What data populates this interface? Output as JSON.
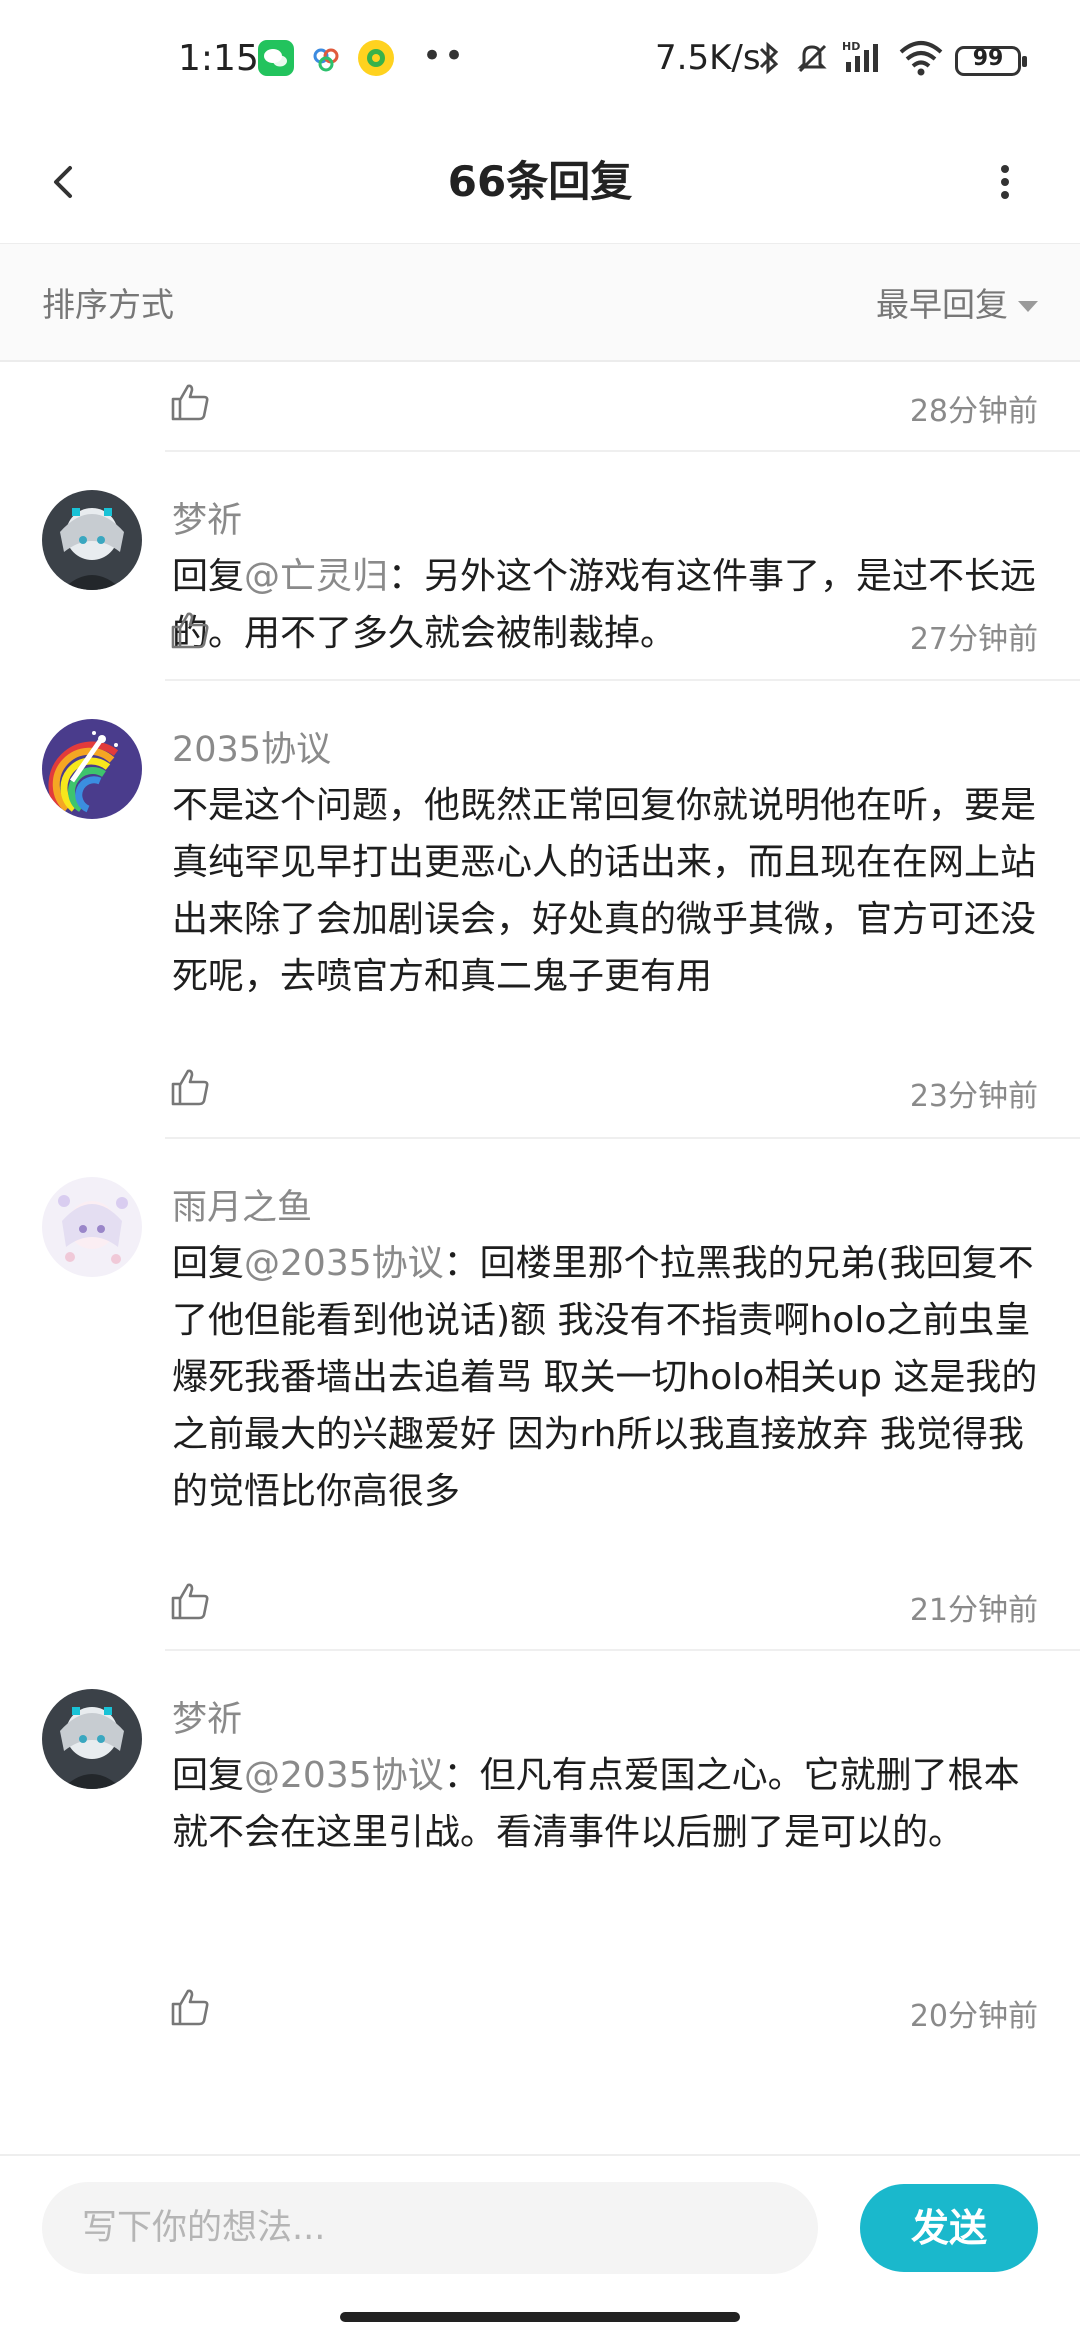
{
  "status_bar": {
    "time": "1:15",
    "net_speed": "7.5K/s",
    "battery": "99",
    "app_icons": [
      "wechat-icon",
      "cloud-app-icon",
      "qq-browser-icon"
    ]
  },
  "header": {
    "title": "66条回复"
  },
  "sort": {
    "label": "排序方式",
    "selected": "最早回复"
  },
  "replies": [
    {
      "time": "28分钟前"
    },
    {
      "author": "梦祈",
      "prefix": "回复",
      "mention": "@亡灵归",
      "text": "：另外这个游戏有这件事了，是过不长远的。用不了多久就会被制裁掉。",
      "time": "27分钟前"
    },
    {
      "author": "2035协议",
      "text": "不是这个问题，他既然正常回复你就说明他在听，要是真纯罕见早打出更恶心人的话出来，而且现在在网上站出来除了会加剧误会，好处真的微乎其微，官方可还没死呢，去喷官方和真二鬼子更有用",
      "time": "23分钟前"
    },
    {
      "author": "雨月之鱼",
      "prefix": "回复",
      "mention": "@2035协议",
      "text": "：回楼里那个拉黑我的兄弟(我回复不了他但能看到他说话)额   我没有不指责啊holo之前虫皇爆死我番墙出去追着骂   取关一切holo相关up   这是我的之前最大的兴趣爱好  因为rh所以我直接放弃  我觉得我的觉悟比你高很多",
      "time": "21分钟前"
    },
    {
      "author": "梦祈",
      "prefix": "回复",
      "mention": "@2035协议",
      "text": "：但凡有点爱国之心。它就删了根本就不会在这里引战。看清事件以后删了是可以的。",
      "time": "20分钟前"
    }
  ],
  "composer": {
    "placeholder": "写下你的想法...",
    "send_label": "发送"
  },
  "colors": {
    "accent": "#1ab8cc",
    "muted_text": "#8a8a8a"
  }
}
